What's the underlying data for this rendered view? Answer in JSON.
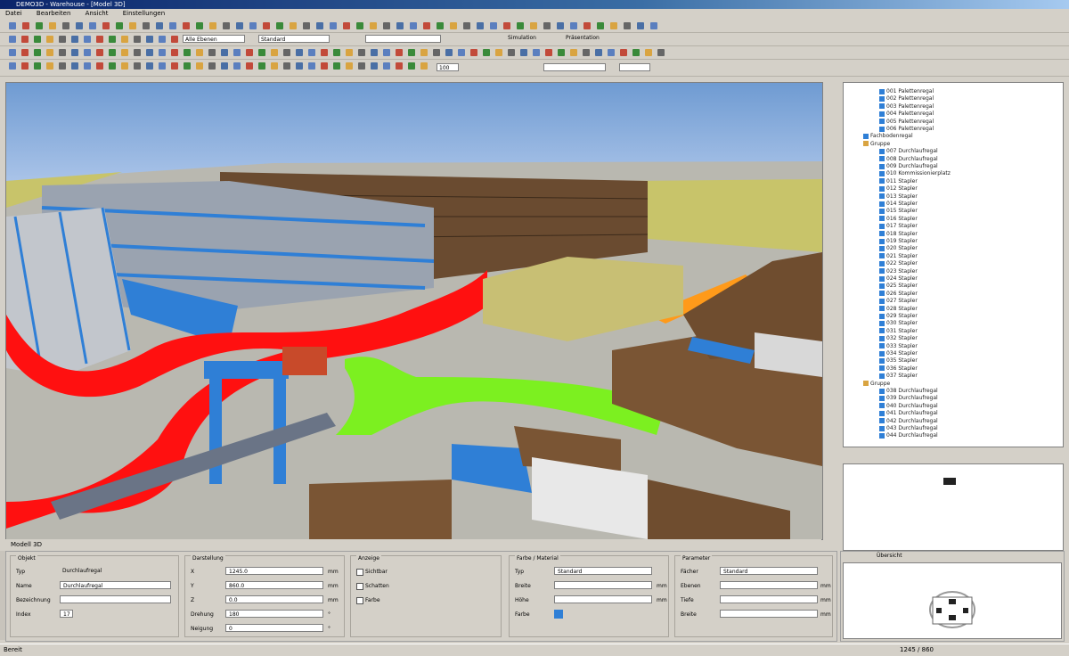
{
  "window": {
    "title": "DEMO3D - Warehouse - [Model 3D]"
  },
  "menu": {
    "items": [
      "Datei",
      "Bearbeiten",
      "Ansicht",
      "Einstellungen"
    ]
  },
  "toolbar": {
    "view_combo": "Alle Ebenen",
    "mode_combo": "Standard",
    "layer_combo": "",
    "text_left": "Simulation",
    "text_right": "Präsentation",
    "zoom_value": "100"
  },
  "viewport": {
    "colors": {
      "sky": "#7aa2d6",
      "ground": "#b9b8b0",
      "red_path": "#ff1010",
      "green_path": "#7cf020",
      "orange_path": "#ff9a1a",
      "rack_blue": "#2f7fd6"
    }
  },
  "viewport_status": {
    "tab": "Modell 3D"
  },
  "tree": {
    "items": [
      "001 Palettenregal",
      "002 Palettenregal",
      "003 Palettenregal",
      "004 Palettenregal",
      "005 Palettenregal",
      "006 Palettenregal",
      "Fachbodenregal",
      "Gruppe",
      "007 Durchlaufregal",
      "008 Durchlaufregal",
      "009 Durchlaufregal",
      "010 Kommissionierplatz",
      "011 Stapler",
      "012 Stapler",
      "013 Stapler",
      "014 Stapler",
      "015 Stapler",
      "016 Stapler",
      "017 Stapler",
      "018 Stapler",
      "019 Stapler",
      "020 Stapler",
      "021 Stapler",
      "022 Stapler",
      "023 Stapler",
      "024 Stapler",
      "025 Stapler",
      "026 Stapler",
      "027 Stapler",
      "028 Stapler",
      "029 Stapler",
      "030 Stapler",
      "031 Stapler",
      "032 Stapler",
      "033 Stapler",
      "034 Stapler",
      "035 Stapler",
      "036 Stapler",
      "037 Stapler",
      "Gruppe",
      "038 Durchlaufregal",
      "039 Durchlaufregal",
      "040 Durchlaufregal",
      "041 Durchlaufregal",
      "042 Durchlaufregal",
      "043 Durchlaufregal",
      "044 Durchlaufregal"
    ]
  },
  "props": {
    "group_object": {
      "title": "Objekt",
      "rows": [
        {
          "label": "Typ",
          "value": "Durchlaufregal"
        },
        {
          "label": "Name",
          "value": "Durchlaufregal"
        },
        {
          "label": "Bezeichnung",
          "value": ""
        },
        {
          "label": "Index",
          "value": "17"
        }
      ]
    },
    "group_position": {
      "title": "Darstellung",
      "rows": [
        {
          "label": "X",
          "value": "1245.0",
          "unit": "mm"
        },
        {
          "label": "Y",
          "value": "860.0",
          "unit": "mm"
        },
        {
          "label": "Z",
          "value": "0.0",
          "unit": "mm"
        },
        {
          "label": "Drehung",
          "value": "180",
          "unit": "°"
        },
        {
          "label": "Neigung",
          "value": "0",
          "unit": "°"
        }
      ]
    },
    "group_display": {
      "title": "Anzeige",
      "checks": [
        "Sichtbar",
        "Schatten",
        "Farbe"
      ]
    },
    "group_color": {
      "title": "Farbe / Material",
      "rows": [
        {
          "label": "Typ",
          "value": "Standard"
        },
        {
          "label": "Breite",
          "value": "",
          "unit": "mm"
        },
        {
          "label": "Höhe",
          "value": "",
          "unit": "mm"
        },
        {
          "label": "Farbe",
          "value": ""
        }
      ]
    },
    "group_params": {
      "title": "Parameter",
      "rows": [
        {
          "label": "Fächer",
          "value": "Standard"
        },
        {
          "label": "Ebenen",
          "value": "",
          "unit": "mm"
        },
        {
          "label": "Tiefe",
          "value": "",
          "unit": "mm"
        },
        {
          "label": "Breite",
          "value": "",
          "unit": "mm"
        }
      ]
    }
  },
  "minimap": {
    "tab": "Übersicht"
  },
  "status": {
    "left": "Bereit",
    "right": "1245 / 860"
  }
}
